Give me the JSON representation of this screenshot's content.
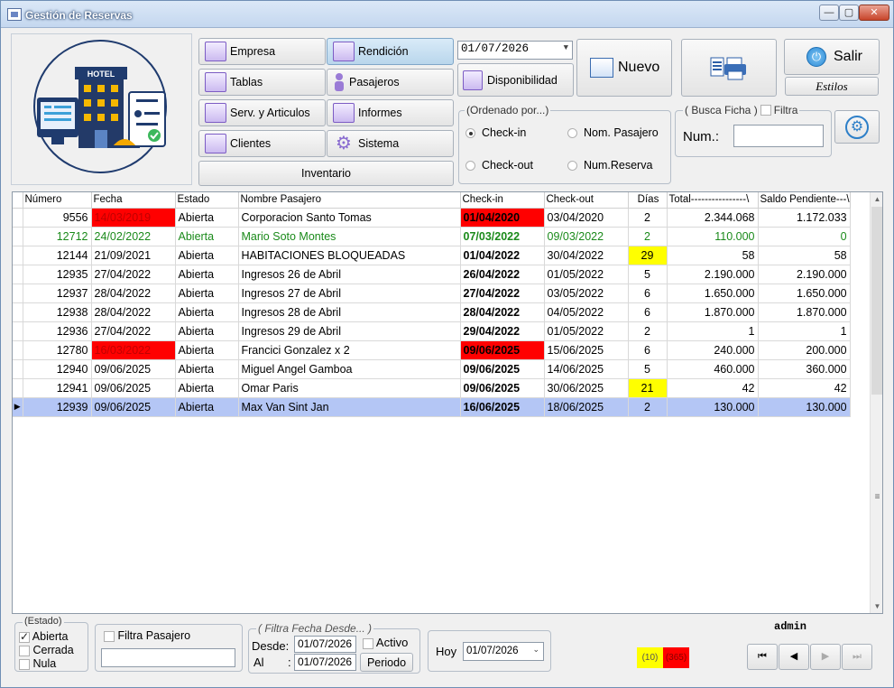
{
  "window": {
    "title": "Gestión de Reservas",
    "min": "—",
    "max": "▢",
    "close": "✕"
  },
  "menu": {
    "empresa": "Empresa",
    "rendicion": "Rendición",
    "tablas": "Tablas",
    "pasajeros": "Pasajeros",
    "serv": "Serv. y Articulos",
    "informes": "Informes",
    "clientes": "Clientes",
    "sistema": "Sistema",
    "inventario": "Inventario"
  },
  "logo": {
    "text": "HOTEL"
  },
  "date_picker": {
    "value": "01/07/2026",
    "icon": "chevron-down-icon"
  },
  "disponibilidad": "Disponibilidad",
  "nuevo": "Nuevo",
  "salir": "Salir",
  "estilos": "Estilos",
  "ordenado": {
    "title": "(Ordenado por...)",
    "checkin": "Check-in",
    "nom_pasajero": "Nom. Pasajero",
    "checkout": "Check-out",
    "num_reserva": "Num.Reserva",
    "selected": "checkin"
  },
  "busca": {
    "title": "( Busca Ficha )",
    "filtra": "Filtra",
    "num_label": "Num.:",
    "num_value": ""
  },
  "grid": {
    "columns": [
      "Número",
      "Fecha",
      "Estado",
      "Nombre Pasajero",
      "Check-in",
      "Check-out",
      "Días",
      "Total----------------\\",
      "Saldo Pendiente---\\"
    ],
    "rows": [
      {
        "num": "9556",
        "fecha": "14/03/2019",
        "estado": "Abierta",
        "nombre": "Corporacion Santo Tomas",
        "checkin": "01/04/2020",
        "checkout": "03/04/2020",
        "dias": "2",
        "total": "2.344.068",
        "saldo": "1.172.033",
        "fecha_red": true,
        "checkin_red": true
      },
      {
        "num": "12712",
        "fecha": "24/02/2022",
        "estado": "Abierta",
        "nombre": "Mario Soto Montes",
        "checkin": "07/03/2022",
        "checkout": "09/03/2022",
        "dias": "2",
        "total": "110.000",
        "saldo": "0",
        "green": true
      },
      {
        "num": "12144",
        "fecha": "21/09/2021",
        "estado": "Abierta",
        "nombre": "HABITACIONES BLOQUEADAS",
        "checkin": "01/04/2022",
        "checkout": "30/04/2022",
        "dias": "29",
        "total": "58",
        "saldo": "58",
        "dias_yellow": true
      },
      {
        "num": "12935",
        "fecha": "27/04/2022",
        "estado": "Abierta",
        "nombre": "Ingresos 26 de Abril",
        "checkin": "26/04/2022",
        "checkout": "01/05/2022",
        "dias": "5",
        "total": "2.190.000",
        "saldo": "2.190.000"
      },
      {
        "num": "12937",
        "fecha": "28/04/2022",
        "estado": "Abierta",
        "nombre": "Ingresos 27 de Abril",
        "checkin": "27/04/2022",
        "checkout": "03/05/2022",
        "dias": "6",
        "total": "1.650.000",
        "saldo": "1.650.000"
      },
      {
        "num": "12938",
        "fecha": "28/04/2022",
        "estado": "Abierta",
        "nombre": "Ingresos 28 de Abril",
        "checkin": "28/04/2022",
        "checkout": "04/05/2022",
        "dias": "6",
        "total": "1.870.000",
        "saldo": "1.870.000"
      },
      {
        "num": "12936",
        "fecha": "27/04/2022",
        "estado": "Abierta",
        "nombre": "Ingresos 29 de Abril",
        "checkin": "29/04/2022",
        "checkout": "01/05/2022",
        "dias": "2",
        "total": "1",
        "saldo": "1"
      },
      {
        "num": "12780",
        "fecha": "16/03/2022",
        "estado": "Abierta",
        "nombre": "Francici Gonzalez x 2",
        "checkin": "09/06/2025",
        "checkout": "15/06/2025",
        "dias": "6",
        "total": "240.000",
        "saldo": "200.000",
        "fecha_red": true,
        "checkin_red": true
      },
      {
        "num": "12940",
        "fecha": "09/06/2025",
        "estado": "Abierta",
        "nombre": "Miguel Angel Gamboa",
        "checkin": "09/06/2025",
        "checkout": "14/06/2025",
        "dias": "5",
        "total": "460.000",
        "saldo": "360.000"
      },
      {
        "num": "12941",
        "fecha": "09/06/2025",
        "estado": "Abierta",
        "nombre": "Omar Paris",
        "checkin": "09/06/2025",
        "checkout": "30/06/2025",
        "dias": "21",
        "total": "42",
        "saldo": "42",
        "dias_yellow": true
      },
      {
        "num": "12939",
        "fecha": "09/06/2025",
        "estado": "Abierta",
        "nombre": "Max Van Sint Jan",
        "checkin": "16/06/2025",
        "checkout": "18/06/2025",
        "dias": "2",
        "total": "130.000",
        "saldo": "130.000",
        "current": true
      }
    ]
  },
  "estado": {
    "title": "(Estado)",
    "abierta": "Abierta",
    "cerrada": "Cerrada",
    "nula": "Nula",
    "abierta_checked": true
  },
  "filtra_pasajero": {
    "label": "Filtra Pasajero",
    "value": ""
  },
  "filtra_fecha": {
    "title": "( Filtra Fecha Desde... )",
    "desde_label": "Desde:",
    "desde": "01/07/2026",
    "al_label": "Al",
    "al_colon": ":",
    "al": "01/07/2026",
    "activo": "Activo",
    "periodo": "Periodo"
  },
  "hoy": {
    "label": "Hoy",
    "value": "01/07/2026"
  },
  "status": {
    "user": "admin",
    "count_yellow": "(10)",
    "count_red": "(365)"
  },
  "nav": {
    "first": "⏮",
    "prev": "◀",
    "next": "▶",
    "last": "⏭"
  }
}
